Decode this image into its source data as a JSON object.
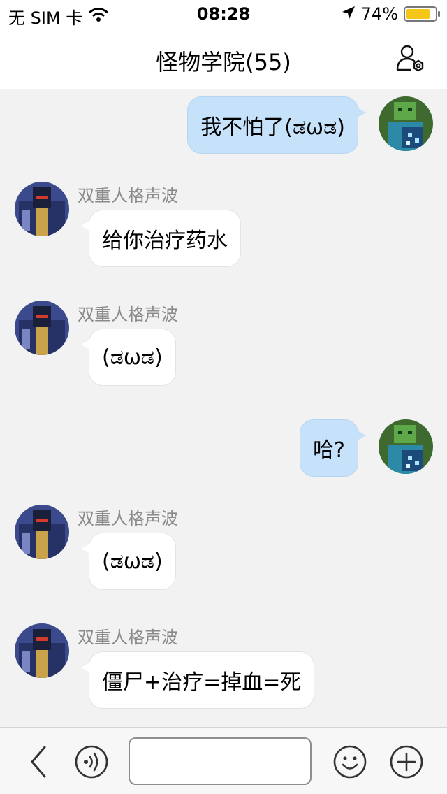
{
  "status_bar": {
    "carrier": "无 SIM 卡",
    "time": "08:28",
    "battery_percent": "74%",
    "battery_level": 0.74,
    "icons": [
      "wifi-icon",
      "location-arrow-icon",
      "battery-icon"
    ]
  },
  "nav": {
    "title": "怪物学院(55)",
    "action_icon": "group-settings-icon"
  },
  "messages": [
    {
      "direction": "outgoing",
      "text": "我不怕了(ಡωಡ)"
    },
    {
      "direction": "incoming",
      "sender": "双重人格声波",
      "text": "给你治疗药水"
    },
    {
      "direction": "incoming",
      "sender": "双重人格声波",
      "text": "(ಡωಡ)"
    },
    {
      "direction": "outgoing",
      "text": "哈?"
    },
    {
      "direction": "incoming",
      "sender": "双重人格声波",
      "text": "(ಡωಡ)"
    },
    {
      "direction": "incoming",
      "sender": "双重人格声波",
      "text": "僵尸+治疗=掉血=死"
    }
  ],
  "input_bar": {
    "value": "",
    "icons": [
      "back-chevron-icon",
      "voice-icon",
      "emoji-icon",
      "add-icon"
    ]
  },
  "colors": {
    "outgoing_bubble": "#c6e2fa",
    "incoming_bubble": "#ffffff",
    "chat_background": "#f2f2f2",
    "battery": "#f5c518"
  }
}
